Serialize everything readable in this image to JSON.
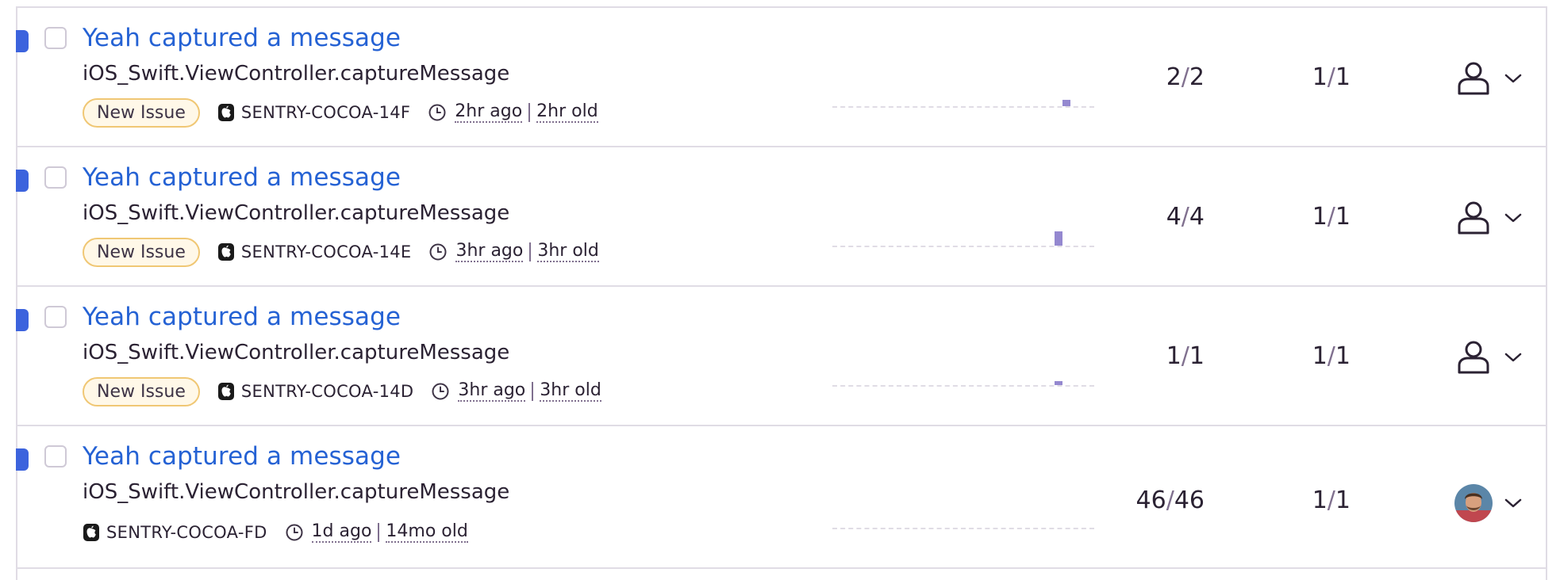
{
  "issues": [
    {
      "title": "Yeah captured a message",
      "culprit": "iOS_Swift.ViewController.captureMessage",
      "badge": "New Issue",
      "short_id": "SENTRY-COCOA-14F",
      "last_seen": "2hr ago",
      "first_seen": "2hr old",
      "events": "2",
      "events_total": "2",
      "users": "1",
      "users_total": "1",
      "assignee": "unassigned-user-icon"
    },
    {
      "title": "Yeah captured a message",
      "culprit": "iOS_Swift.ViewController.captureMessage",
      "badge": "New Issue",
      "short_id": "SENTRY-COCOA-14E",
      "last_seen": "3hr ago",
      "first_seen": "3hr old",
      "events": "4",
      "events_total": "4",
      "users": "1",
      "users_total": "1",
      "assignee": "unassigned-user-icon"
    },
    {
      "title": "Yeah captured a message",
      "culprit": "iOS_Swift.ViewController.captureMessage",
      "badge": "New Issue",
      "short_id": "SENTRY-COCOA-14D",
      "last_seen": "3hr ago",
      "first_seen": "3hr old",
      "events": "1",
      "events_total": "1",
      "users": "1",
      "users_total": "1",
      "assignee": "unassigned-user-icon"
    },
    {
      "title": "Yeah captured a message",
      "culprit": "iOS_Swift.ViewController.captureMessage",
      "short_id": "SENTRY-COCOA-FD",
      "last_seen": "1d ago",
      "first_seen": "14mo old",
      "events": "46",
      "events_total": "46",
      "users": "1",
      "users_total": "1",
      "assignee": "user-avatar"
    }
  ],
  "slash": "/",
  "colors": {
    "link": "#2562d4",
    "unread": "#3c63dd",
    "graph": "#9488d0",
    "badge_border": "#f0c774"
  }
}
